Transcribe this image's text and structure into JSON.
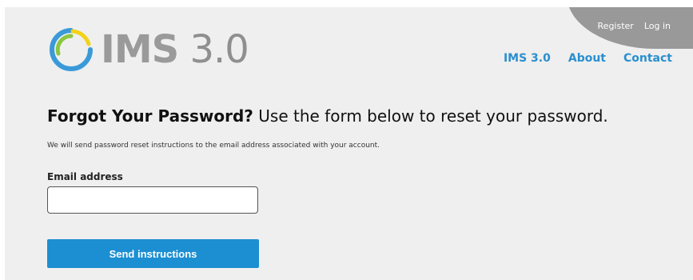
{
  "header": {
    "logo": {
      "text": "IMS",
      "version": "3.0"
    },
    "account_links": {
      "register": "Register",
      "login": "Log in"
    },
    "nav": {
      "home": "IMS 3.0",
      "about": "About",
      "contact": "Contact"
    }
  },
  "main": {
    "heading_strong": "Forgot Your Password?",
    "heading_rest": " Use the form below to reset your password.",
    "subtext": "We will send password reset instructions to the email address associated with your account.",
    "email_label": "Email address",
    "email_value": "",
    "email_placeholder": "",
    "submit_label": "Send instructions"
  },
  "colors": {
    "accent": "#1c8fd2",
    "nav_link": "#2a8fcf",
    "background": "#efefef",
    "header_tab": "#999999"
  }
}
